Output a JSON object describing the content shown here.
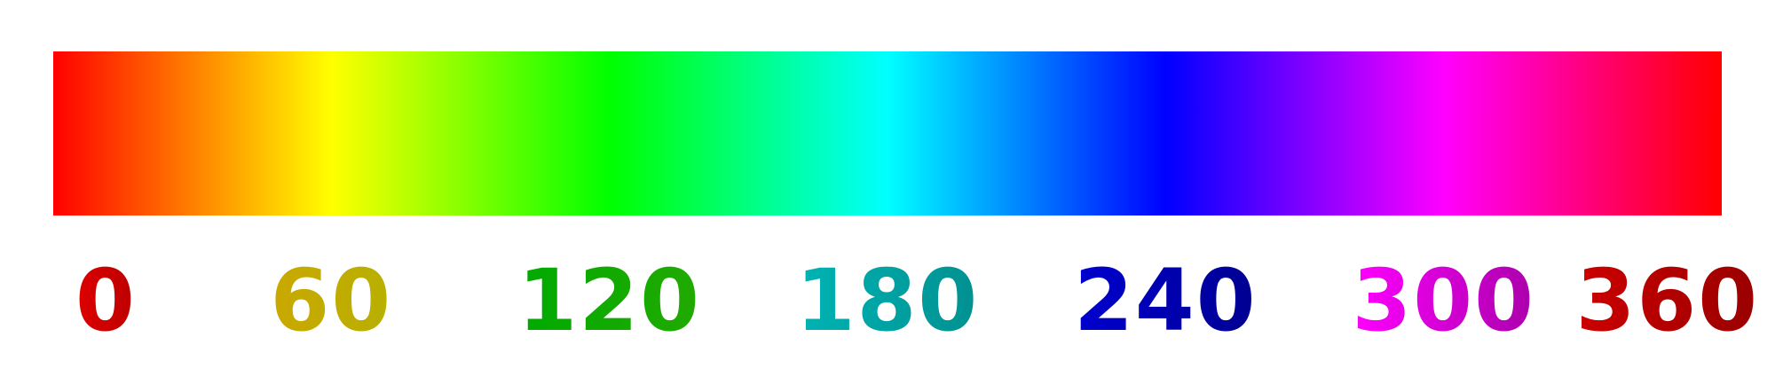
{
  "hue_scale": {
    "stops": [
      {
        "hue": 0,
        "color": "#ff0000"
      },
      {
        "hue": 60,
        "color": "#ffff00"
      },
      {
        "hue": 120,
        "color": "#00ff00"
      },
      {
        "hue": 180,
        "color": "#00ffff"
      },
      {
        "hue": 240,
        "color": "#0000ff"
      },
      {
        "hue": 300,
        "color": "#ff00ff"
      },
      {
        "hue": 360,
        "color": "#ff0000"
      }
    ],
    "labels": [
      {
        "text": "0",
        "hue": 0,
        "gradient": [
          "#dd0000",
          "#bb0000"
        ]
      },
      {
        "text": "60",
        "hue": 60,
        "gradient": [
          "#c9a800",
          "#b8b000"
        ]
      },
      {
        "text": "120",
        "hue": 120,
        "gradient": [
          "#00aa00",
          "#22aa00"
        ]
      },
      {
        "text": "180",
        "hue": 180,
        "gradient": [
          "#00b4b4",
          "#009090"
        ]
      },
      {
        "text": "240",
        "hue": 240,
        "gradient": [
          "#0000d0",
          "#000090"
        ]
      },
      {
        "text": "300",
        "hue": 300,
        "gradient": [
          "#ff00ff",
          "#aa00aa"
        ]
      },
      {
        "text": "360",
        "hue": 360,
        "gradient": [
          "#cc0000",
          "#990000"
        ]
      }
    ]
  }
}
